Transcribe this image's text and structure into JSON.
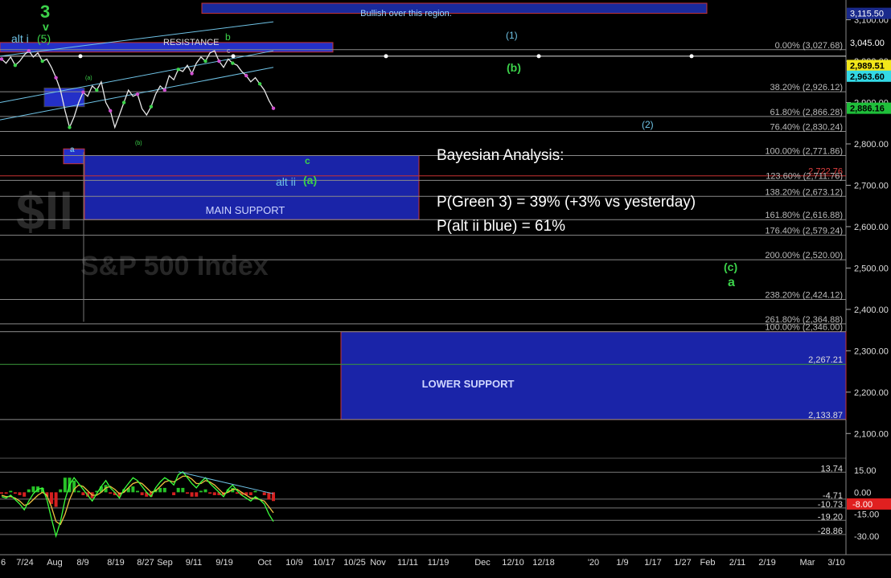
{
  "chart_data": {
    "type": "line",
    "title": "S&P 500 Index",
    "background": "#000000",
    "x_axis": {
      "tick_labels": [
        "6",
        "7/24",
        "Aug",
        "8/9",
        "8/19",
        "8/27",
        "Sep",
        "9/11",
        "9/19",
        "Oct",
        "10/9",
        "10/17",
        "10/25",
        "Nov",
        "11/11",
        "11/19",
        "Dec",
        "12/10",
        "12/18",
        "'20",
        "1/9",
        "1/17",
        "1/27",
        "Feb",
        "2/11",
        "2/19",
        "Mar",
        "3/10"
      ]
    },
    "y_axis": {
      "ylim": [
        2050,
        3140
      ],
      "tick_values": [
        2100,
        2200,
        2300,
        2400,
        2500,
        2600,
        2700,
        2800,
        2900,
        3000,
        3100
      ],
      "tick_labels": [
        "2,100.00",
        "2,200.00",
        "2,300.00",
        "2,400.00",
        "2,500.00",
        "2,600.00",
        "2,700.00",
        "2,800.00",
        "2,900.00",
        "3,000.00",
        "3,100.00"
      ]
    },
    "price_axis_tags": [
      {
        "label": "3,115.50",
        "value": 3115.5,
        "color": "#1a2a8c"
      },
      {
        "label": "3,045.00",
        "value": 3045.0,
        "color": "#000000"
      },
      {
        "label": "2,989.51",
        "value": 2989.5,
        "color": "#f2e61a"
      },
      {
        "label": "2,963.60",
        "value": 2963.6,
        "color": "#33d9e6"
      },
      {
        "label": "2,886.16",
        "value": 2886.2,
        "color": "#1fbf3a"
      },
      {
        "label": "2,267.21",
        "value": 2267.2,
        "color": "#000000"
      },
      {
        "label": "2,133.87",
        "value": 2133.9,
        "color": "#000000"
      }
    ],
    "fib_levels": [
      {
        "label": "0.00% (3,027.68)",
        "value": 3027.7,
        "color": "#bbbbbb"
      },
      {
        "label": "38.20% (2,926.12)",
        "value": 2926.1,
        "color": "#bbbbbb"
      },
      {
        "label": "61.80% (2,866.28)",
        "value": 2866.3,
        "color": "#bbbbbb"
      },
      {
        "label": "76.40% (2,830.24)",
        "value": 2830.2,
        "color": "#bbbbbb"
      },
      {
        "label": "100.00% (2,771.86)",
        "value": 2771.9,
        "color": "#bbbbbb"
      },
      {
        "label": "2,722.76",
        "value": 2722.8,
        "color": "#e04040"
      },
      {
        "label": "123.60% (2,711.76)",
        "value": 2711.8,
        "color": "#bbbbbb"
      },
      {
        "label": "138.20% (2,673.12)",
        "value": 2673.1,
        "color": "#bbbbbb"
      },
      {
        "label": "161.80% (2,616.88)",
        "value": 2616.9,
        "color": "#bbbbbb"
      },
      {
        "label": "176.40% (2,579.24)",
        "value": 2579.2,
        "color": "#bbbbbb"
      },
      {
        "label": "200.00% (2,520.00)",
        "value": 2520.0,
        "color": "#bbbbbb"
      },
      {
        "label": "238.20% (2,424.12)",
        "value": 2424.1,
        "color": "#bbbbbb"
      },
      {
        "label": "261.80% (2,364.88)",
        "value": 2364.9,
        "color": "#bbbbbb"
      },
      {
        "label": "100.00% (2,346.00)",
        "value": 2346.0,
        "color": "#bbbbbb"
      }
    ],
    "zones": [
      {
        "label": "Bullish over this region.",
        "low": 3115.5,
        "high": 3140
      },
      {
        "label": "RESISTANCE",
        "low": 3022,
        "high": 3045
      },
      {
        "label": "MAIN SUPPORT",
        "low": 2616.9,
        "high": 2771.9
      },
      {
        "label": "LOWER SUPPORT",
        "low": 2133.9,
        "high": 2346.0
      }
    ],
    "price_series": {
      "name": "S&P 500",
      "color": "#e8e8e8",
      "values": [
        3005,
        2995,
        3010,
        2990,
        3000,
        3015,
        3025,
        3010,
        3020,
        3000,
        3005,
        2985,
        2960,
        2930,
        2880,
        2840,
        2865,
        2900,
        2925,
        2915,
        2940,
        2930,
        2950,
        2900,
        2880,
        2840,
        2870,
        2900,
        2930,
        2915,
        2920,
        2885,
        2870,
        2890,
        2920,
        2940,
        2930,
        2965,
        2955,
        2980,
        2975,
        2990,
        2970,
        2995,
        3010,
        3000,
        3020,
        3025,
        3000,
        2985,
        3005,
        2995,
        2990,
        2975,
        2965,
        2950,
        2960,
        2945,
        2930,
        2905,
        2886
      ]
    },
    "text_annotations": {
      "bayes_heading": "Bayesian Analysis:",
      "bayes_green": "P(Green 3) = 39% (+3% vs yesterday)",
      "bayes_alt": "P(alt ii blue) = 61%",
      "watermark_short": "$ll",
      "watermark_index": "S&P 500 Index",
      "wave_3": "3",
      "wave_v": "v",
      "wave_5": "(5)",
      "wave_alt_i": "alt i",
      "wave_b_top": "b",
      "wave_c_top": "c",
      "wave_1": "(1)",
      "wave_b_paren": "(b)",
      "wave_2": "(2)",
      "wave_c_mid": "c",
      "wave_alt_ii": "alt ii",
      "wave_a_paren": "(a)",
      "wave_a_small": "a",
      "wave_c_paren": "(c)",
      "wave_a_right": "a",
      "small_a": "(a)",
      "small_b": "(b)"
    },
    "oscillator": {
      "ylim": [
        -35,
        20
      ],
      "tick_labels": [
        "15.00",
        "0.00",
        "-15.00",
        "-30.00"
      ],
      "tick_values": [
        15,
        0,
        -15,
        -30
      ],
      "levels": [
        {
          "label": "13.74",
          "value": 13.74
        },
        {
          "label": "-4.71",
          "value": -4.71
        },
        {
          "label": "-10.73",
          "value": -10.73
        },
        {
          "label": "-19.20",
          "value": -19.2
        },
        {
          "label": "-28.86",
          "value": -28.86
        }
      ],
      "current_tag": {
        "label": "-8.00",
        "value": -8.0,
        "color": "#e02020"
      },
      "fast_line": {
        "color": "#3cff3c",
        "values": [
          -3,
          -4,
          -2,
          -5,
          -8,
          -12,
          -6,
          -1,
          2,
          3,
          -5,
          -18,
          -30,
          -20,
          -5,
          5,
          10,
          6,
          2,
          -2,
          -6,
          -1,
          4,
          8,
          3,
          0,
          -4,
          2,
          6,
          10,
          8,
          4,
          0,
          -3,
          3,
          7,
          10,
          8,
          5,
          12,
          14,
          10,
          6,
          3,
          7,
          10,
          6,
          3,
          0,
          -3,
          2,
          5,
          1,
          -2,
          -4,
          -6,
          -3,
          -5,
          -8,
          -15,
          -20
        ]
      },
      "slow_line": {
        "color": "#f0c040",
        "values": [
          -2,
          -3,
          -3,
          -4,
          -6,
          -9,
          -8,
          -5,
          -2,
          0,
          -2,
          -10,
          -20,
          -22,
          -15,
          -5,
          2,
          5,
          4,
          1,
          -2,
          -2,
          0,
          3,
          4,
          2,
          -1,
          0,
          3,
          6,
          7,
          6,
          3,
          0,
          1,
          4,
          7,
          8,
          7,
          9,
          11,
          11,
          9,
          6,
          6,
          8,
          7,
          5,
          2,
          -1,
          0,
          2,
          2,
          0,
          -2,
          -4,
          -4,
          -5,
          -6,
          -10,
          -14
        ]
      }
    }
  }
}
